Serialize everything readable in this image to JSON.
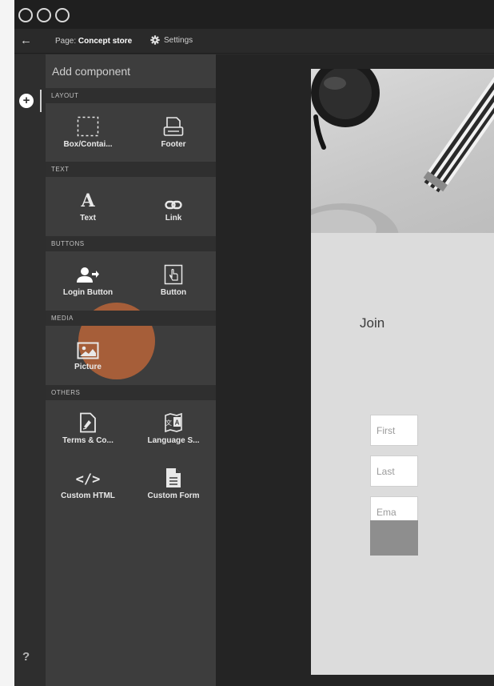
{
  "toolbar": {
    "page_prefix": "Page:",
    "page_name": "Concept store",
    "settings_label": "Settings"
  },
  "rail": {
    "help_label": "?"
  },
  "panel": {
    "title": "Add component",
    "sections": {
      "layout": "LAYOUT",
      "text": "TEXT",
      "buttons": "BUTTONS",
      "media": "MEDIA",
      "others": "OTHERS"
    },
    "items": {
      "box": "Box/Contai...",
      "footer": "Footer",
      "text": "Text",
      "text_glyph": "A",
      "link": "Link",
      "login_button": "Login Button",
      "button": "Button",
      "picture": "Picture",
      "terms": "Terms & Co...",
      "language": "Language S...",
      "custom_html": "Custom HTML",
      "html_glyph": "</>",
      "custom_form": "Custom Form"
    }
  },
  "preview": {
    "heading": "Join",
    "fields": {
      "first": "First",
      "last": "Last",
      "email": "Ema"
    }
  },
  "colors": {
    "highlight": "#c46838",
    "panel_bg": "#3d3d3d",
    "canvas_bg": "#242424"
  }
}
